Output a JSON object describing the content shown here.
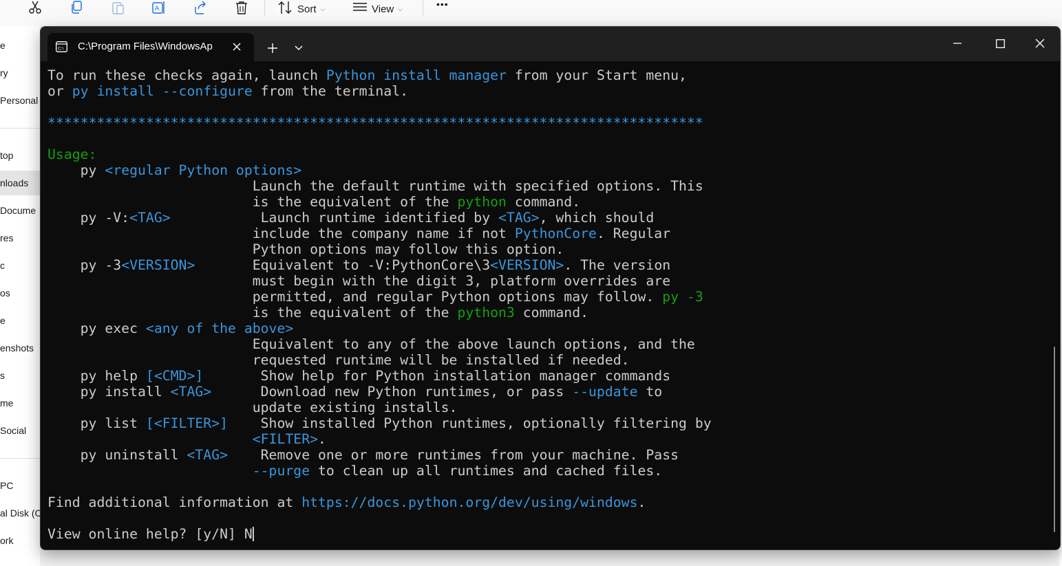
{
  "explorer": {
    "toolbar": {
      "sort_label": "Sort",
      "view_label": "View",
      "more_label": "•••"
    },
    "sidebar_items": [
      {
        "label": "e"
      },
      {
        "label": "ry"
      },
      {
        "label": " Personal"
      },
      {
        "label": "top"
      },
      {
        "label": "nloads"
      },
      {
        "label": " Docume"
      },
      {
        "label": "res"
      },
      {
        "label": "c"
      },
      {
        "label": "os"
      },
      {
        "label": "e"
      },
      {
        "label": "enshots"
      },
      {
        "label": "s"
      },
      {
        "label": "me"
      },
      {
        "label": "Social"
      },
      {
        "label": "PC"
      },
      {
        "label": "al Disk (C"
      },
      {
        "label": "ork"
      }
    ]
  },
  "terminal": {
    "tab_title": "C:\\Program Files\\WindowsAp",
    "lines": [
      [
        {
          "t": "To run these checks again, launch "
        },
        {
          "t": "Python install manager",
          "c": "blue"
        },
        {
          "t": " from your Start menu,"
        }
      ],
      [
        {
          "t": "or "
        },
        {
          "t": "py install --configure",
          "c": "blue"
        },
        {
          "t": " from the terminal."
        }
      ],
      [],
      [
        {
          "t": "********************************************************************************",
          "c": "blue"
        }
      ],
      [],
      [
        {
          "t": "Usage:",
          "c": "green"
        }
      ],
      [
        {
          "t": "    py "
        },
        {
          "t": "<regular Python options>",
          "c": "blue"
        }
      ],
      [
        {
          "t": "                         Launch the default runtime with specified options. This"
        }
      ],
      [
        {
          "t": "                         is the equivalent of the "
        },
        {
          "t": "python",
          "c": "green"
        },
        {
          "t": " command."
        }
      ],
      [
        {
          "t": "    py -V:"
        },
        {
          "t": "<TAG>",
          "c": "blue"
        },
        {
          "t": "           Launch runtime identified by "
        },
        {
          "t": "<TAG>",
          "c": "blue"
        },
        {
          "t": ", which should"
        }
      ],
      [
        {
          "t": "                         include the company name if not "
        },
        {
          "t": "PythonCore",
          "c": "blue"
        },
        {
          "t": ". Regular"
        }
      ],
      [
        {
          "t": "                         Python options may follow this option."
        }
      ],
      [
        {
          "t": "    py -3"
        },
        {
          "t": "<VERSION>",
          "c": "blue"
        },
        {
          "t": "       Equivalent to -V:PythonCore\\3"
        },
        {
          "t": "<VERSION>",
          "c": "blue"
        },
        {
          "t": ". The version"
        }
      ],
      [
        {
          "t": "                         must begin with the digit 3, platform overrides are"
        }
      ],
      [
        {
          "t": "                         permitted, and regular Python options may follow. "
        },
        {
          "t": "py -3",
          "c": "green"
        }
      ],
      [
        {
          "t": "                         is the equivalent of the "
        },
        {
          "t": "python3",
          "c": "green"
        },
        {
          "t": " command."
        }
      ],
      [
        {
          "t": "    py exec "
        },
        {
          "t": "<any of the above>",
          "c": "blue"
        }
      ],
      [
        {
          "t": "                         Equivalent to any of the above launch options, and the"
        }
      ],
      [
        {
          "t": "                         requested runtime will be installed if needed."
        }
      ],
      [
        {
          "t": "    py help "
        },
        {
          "t": "[<CMD>]",
          "c": "blue"
        },
        {
          "t": "       Show help for Python installation manager commands"
        }
      ],
      [
        {
          "t": "    py install "
        },
        {
          "t": "<TAG>",
          "c": "blue"
        },
        {
          "t": "      Download new Python runtimes, or pass "
        },
        {
          "t": "--update",
          "c": "blue"
        },
        {
          "t": " to"
        }
      ],
      [
        {
          "t": "                         update existing installs."
        }
      ],
      [
        {
          "t": "    py list "
        },
        {
          "t": "[<FILTER>]",
          "c": "blue"
        },
        {
          "t": "    Show installed Python runtimes, optionally filtering by"
        }
      ],
      [
        {
          "t": "                         "
        },
        {
          "t": "<FILTER>",
          "c": "blue"
        },
        {
          "t": "."
        }
      ],
      [
        {
          "t": "    py uninstall "
        },
        {
          "t": "<TAG>",
          "c": "blue"
        },
        {
          "t": "    Remove one or more runtimes from your machine. Pass"
        }
      ],
      [
        {
          "t": "                         "
        },
        {
          "t": "--purge",
          "c": "blue"
        },
        {
          "t": " to clean up all runtimes and cached files."
        }
      ],
      [],
      [
        {
          "t": "Find additional information at "
        },
        {
          "t": "https://docs.python.org/dev/using/windows",
          "c": "blue"
        },
        {
          "t": "."
        }
      ],
      [],
      [
        {
          "t": "View online help? [y/N] N"
        },
        {
          "cursor": true
        }
      ]
    ]
  },
  "colors": {
    "terminal_background": "#0c0c0c",
    "terminal_foreground": "#cccccc",
    "blue": "#3a96dd",
    "green": "#13a10e",
    "titlebar": "#202020"
  }
}
